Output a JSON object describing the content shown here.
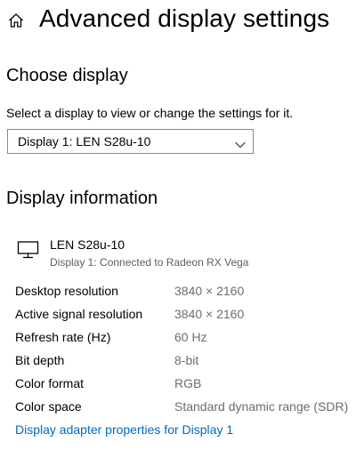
{
  "header": {
    "title": "Advanced display settings",
    "home_icon": "home-icon"
  },
  "choose_display": {
    "title": "Choose display",
    "instruction": "Select a display to view or change the settings for it.",
    "dropdown": {
      "selected": "Display 1: LEN S28u-10",
      "icon": "chevron-down-icon"
    }
  },
  "display_info": {
    "title": "Display information",
    "monitor": {
      "icon": "monitor-icon",
      "name": "LEN S28u-10",
      "subtitle": "Display 1: Connected to Radeon RX Vega"
    },
    "rows": [
      {
        "label": "Desktop resolution",
        "value": "3840 × 2160"
      },
      {
        "label": "Active signal resolution",
        "value": "3840 × 2160"
      },
      {
        "label": "Refresh rate (Hz)",
        "value": "60 Hz"
      },
      {
        "label": "Bit depth",
        "value": "8-bit"
      },
      {
        "label": "Color format",
        "value": "RGB"
      },
      {
        "label": "Color space",
        "value": "Standard dynamic range (SDR)"
      }
    ],
    "adapter_link": "Display adapter properties for Display 1"
  },
  "colors": {
    "link": "#0067c0",
    "secondary_text": "#6d6d6d",
    "border": "#8a8a8a"
  }
}
